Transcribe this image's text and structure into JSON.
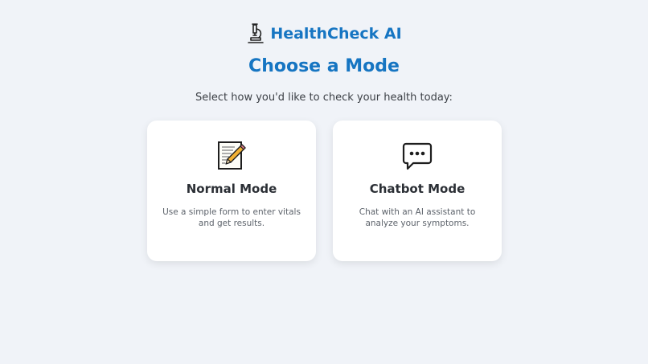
{
  "header": {
    "brand_icon": "microscope-icon",
    "brand_name": "HealthCheck AI"
  },
  "main": {
    "title": "Choose a Mode",
    "subtitle": "Select how you'd like to check your health today:"
  },
  "modes": [
    {
      "icon": "memo-pencil-icon",
      "title": "Normal Mode",
      "description": "Use a simple form to enter vitals and get results."
    },
    {
      "icon": "chat-bubble-icon",
      "title": "Chatbot Mode",
      "description": "Chat with an AI assistant to analyze your symptoms."
    }
  ],
  "colors": {
    "accent": "#1675c2",
    "background": "#f0f3f8",
    "card": "#ffffff"
  }
}
